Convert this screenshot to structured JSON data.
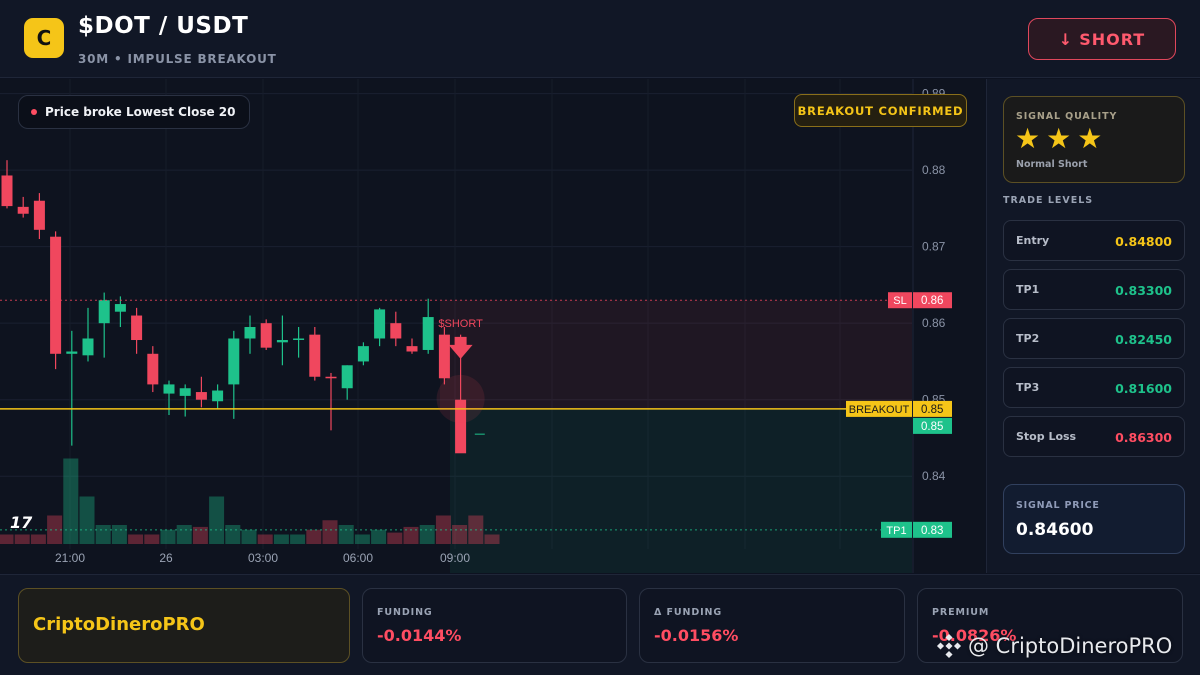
{
  "header": {
    "logo_letter": "C",
    "title": "$DOT / USDT",
    "subtitle": "30M • IMPULSE BREAKOUT",
    "short_button": {
      "arrow": "↓",
      "label": "SHORT"
    }
  },
  "chart": {
    "price_note": "Price broke Lowest Close 20",
    "breakout_badge": "BREAKOUT CONFIRMED",
    "tv_logo": "17",
    "short_marker_label": "$SHORT",
    "price_ticks": [
      "0.89",
      "0.88",
      "0.87",
      "0.86",
      "0.85",
      "0.84"
    ],
    "time_ticks": [
      "21:00",
      "26",
      "03:00",
      "06:00",
      "09:00"
    ],
    "line_labels": {
      "sl": {
        "name": "SL",
        "value": "0.86"
      },
      "breakout": {
        "name": "BREAKOUT",
        "value": "0.85"
      },
      "current": {
        "value": "0.85"
      },
      "tp1": {
        "name": "TP1",
        "value": "0.83"
      }
    },
    "colors": {
      "up": "#1ec28b",
      "down": "#f0475e",
      "breakout": "#f5c518",
      "sl": "#f0475e",
      "tp": "#1ec28b"
    }
  },
  "chart_data": {
    "type": "candlestick",
    "ylim": [
      0.8318,
      0.8906
    ],
    "price_levels": {
      "sl": 0.863,
      "breakout": 0.8488,
      "tp1": 0.833,
      "current": 0.846
    },
    "candles": [
      {
        "o": 0.8793,
        "h": 0.8813,
        "l": 0.875,
        "c": 0.8753
      },
      {
        "o": 0.8752,
        "h": 0.8765,
        "l": 0.8738,
        "c": 0.8743
      },
      {
        "o": 0.876,
        "h": 0.877,
        "l": 0.871,
        "c": 0.8722
      },
      {
        "o": 0.8713,
        "h": 0.872,
        "l": 0.854,
        "c": 0.856
      },
      {
        "o": 0.856,
        "h": 0.859,
        "l": 0.844,
        "c": 0.8563
      },
      {
        "o": 0.8558,
        "h": 0.862,
        "l": 0.855,
        "c": 0.858
      },
      {
        "o": 0.86,
        "h": 0.864,
        "l": 0.8555,
        "c": 0.863
      },
      {
        "o": 0.8615,
        "h": 0.8635,
        "l": 0.8595,
        "c": 0.8625
      },
      {
        "o": 0.861,
        "h": 0.862,
        "l": 0.856,
        "c": 0.8578
      },
      {
        "o": 0.856,
        "h": 0.857,
        "l": 0.851,
        "c": 0.852
      },
      {
        "o": 0.8508,
        "h": 0.8525,
        "l": 0.848,
        "c": 0.852
      },
      {
        "o": 0.8505,
        "h": 0.852,
        "l": 0.8478,
        "c": 0.8515
      },
      {
        "o": 0.851,
        "h": 0.853,
        "l": 0.849,
        "c": 0.85
      },
      {
        "o": 0.8498,
        "h": 0.852,
        "l": 0.8488,
        "c": 0.8512
      },
      {
        "o": 0.852,
        "h": 0.859,
        "l": 0.8475,
        "c": 0.858
      },
      {
        "o": 0.858,
        "h": 0.861,
        "l": 0.856,
        "c": 0.8595
      },
      {
        "o": 0.86,
        "h": 0.8605,
        "l": 0.8565,
        "c": 0.8568
      },
      {
        "o": 0.8575,
        "h": 0.861,
        "l": 0.8545,
        "c": 0.8578
      },
      {
        "o": 0.858,
        "h": 0.8595,
        "l": 0.8555,
        "c": 0.858
      },
      {
        "o": 0.8585,
        "h": 0.8595,
        "l": 0.8525,
        "c": 0.853
      },
      {
        "o": 0.853,
        "h": 0.8535,
        "l": 0.846,
        "c": 0.8528
      },
      {
        "o": 0.8515,
        "h": 0.8545,
        "l": 0.85,
        "c": 0.8545
      },
      {
        "o": 0.855,
        "h": 0.8575,
        "l": 0.8545,
        "c": 0.857
      },
      {
        "o": 0.858,
        "h": 0.862,
        "l": 0.857,
        "c": 0.8618
      },
      {
        "o": 0.86,
        "h": 0.8615,
        "l": 0.857,
        "c": 0.858
      },
      {
        "o": 0.857,
        "h": 0.858,
        "l": 0.856,
        "c": 0.8563
      },
      {
        "o": 0.8565,
        "h": 0.8632,
        "l": 0.856,
        "c": 0.8608
      },
      {
        "o": 0.8585,
        "h": 0.8595,
        "l": 0.852,
        "c": 0.8528
      },
      {
        "o": 0.85,
        "h": 0.8585,
        "l": 0.8455,
        "c": 0.843
      }
    ],
    "volumes": [
      1,
      1,
      1,
      3,
      9,
      5,
      2,
      2,
      1,
      1,
      1.5,
      2,
      1.8,
      5,
      2,
      1.5,
      1,
      1,
      1,
      1.5,
      2.5,
      2,
      1,
      1.5,
      1.2,
      1.8,
      2,
      3,
      2,
      3,
      1
    ],
    "time_labels": [
      "21:00",
      "26",
      "03:00",
      "06:00",
      "09:00"
    ]
  },
  "sidebar": {
    "quality": {
      "label": "SIGNAL QUALITY",
      "stars": 3,
      "subtitle": "Normal Short"
    },
    "levels_title": "TRADE LEVELS",
    "levels": [
      {
        "name": "Entry",
        "value": "0.84800",
        "color": "#f5c518"
      },
      {
        "name": "TP1",
        "value": "0.83300",
        "color": "#1ec28b"
      },
      {
        "name": "TP2",
        "value": "0.82450",
        "color": "#1ec28b"
      },
      {
        "name": "TP3",
        "value": "0.81600",
        "color": "#1ec28b"
      },
      {
        "name": "Stop Loss",
        "value": "0.86300",
        "color": "#ff4d62"
      }
    ],
    "signal": {
      "label": "SIGNAL PRICE",
      "value": "0.84600"
    }
  },
  "footer": {
    "brand": "CriptoDineroPRO",
    "metrics": [
      {
        "label": "FUNDING",
        "value": "-0.0144%"
      },
      {
        "label": "Δ FUNDING",
        "value": "-0.0156%"
      },
      {
        "label": "PREMIUM",
        "value": "-0.0826%"
      }
    ],
    "watermark": "@ CriptoDineroPRO"
  }
}
